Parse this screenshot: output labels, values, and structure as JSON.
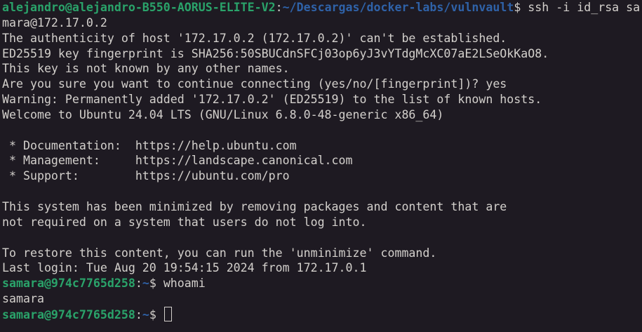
{
  "colors": {
    "background": "#1e1a22",
    "text": "#d3d0cc",
    "prompt_user": "#2aa36a",
    "prompt_path": "#2f62a8"
  },
  "lines": [
    {
      "user": "alejandro@alejandro-B550-AORUS-ELITE-V2",
      "path": "~/Descargas/docker-labs/vulnvault",
      "cmd": "ssh -i id_rsa sa"
    },
    {
      "text": "mara@172.17.0.2"
    },
    {
      "text": "The authenticity of host '172.17.0.2 (172.17.0.2)' can't be established."
    },
    {
      "text": "ED25519 key fingerprint is SHA256:50SBUCdnSFCj03op6yJ3vYTdgMcXC07aE2LSeOkKaO8."
    },
    {
      "text": "This key is not known by any other names."
    },
    {
      "text": "Are you sure you want to continue connecting (yes/no/[fingerprint])? yes"
    },
    {
      "text": "Warning: Permanently added '172.17.0.2' (ED25519) to the list of known hosts."
    },
    {
      "text": "Welcome to Ubuntu 24.04 LTS (GNU/Linux 6.8.0-48-generic x86_64)"
    },
    {
      "text": ""
    },
    {
      "text": " * Documentation:  https://help.ubuntu.com"
    },
    {
      "text": " * Management:     https://landscape.canonical.com"
    },
    {
      "text": " * Support:        https://ubuntu.com/pro"
    },
    {
      "text": ""
    },
    {
      "text": "This system has been minimized by removing packages and content that are"
    },
    {
      "text": "not required on a system that users do not log into."
    },
    {
      "text": ""
    },
    {
      "text": "To restore this content, you can run the 'unminimize' command."
    },
    {
      "text": "Last login: Tue Aug 20 19:54:15 2024 from 172.17.0.1"
    },
    {
      "user": "samara@974c7765d258",
      "path": "~",
      "cmd": "whoami"
    },
    {
      "text": "samara"
    },
    {
      "user": "samara@974c7765d258",
      "path": "~",
      "cmd": ""
    }
  ]
}
